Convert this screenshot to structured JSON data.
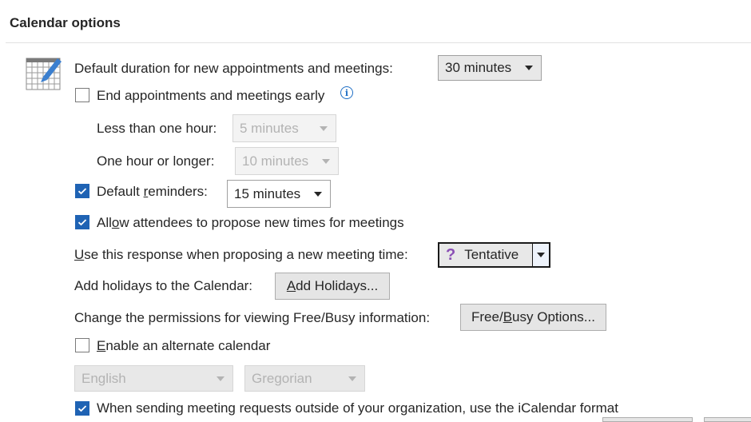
{
  "section": {
    "title": "Calendar options"
  },
  "icons": {
    "calendar": "calendar-edit-icon",
    "info": "info-icon",
    "check": "checkmark-icon",
    "tentative": "question-mark-icon"
  },
  "colors": {
    "accent": "#1f63b4",
    "tentative": "#8a4fb5",
    "info": "#1f6fc5"
  },
  "default_duration": {
    "label": "Default duration for new appointments and meetings:",
    "value": "30 minutes"
  },
  "end_early": {
    "label": "End appointments and meetings early",
    "checked": false
  },
  "less_than_hour": {
    "label": "Less than one hour:",
    "value": "5 minutes"
  },
  "hour_or_longer": {
    "label": "One hour or longer:",
    "value": "10 minutes"
  },
  "default_reminders": {
    "label_pre": "Default ",
    "label_mn": "r",
    "label_post": "eminders:",
    "checked": true,
    "value": "15 minutes"
  },
  "allow_propose": {
    "label_pre": "All",
    "label_mn": "o",
    "label_post": "w attendees to propose new times for meetings",
    "checked": true
  },
  "response": {
    "label_mn": "U",
    "label_post": "se this response when proposing a new meeting time:",
    "value": "Tentative"
  },
  "holidays": {
    "label": "Add holidays to the Calendar:",
    "button_mn": "A",
    "button_post": "dd Holidays..."
  },
  "freebusy": {
    "label": "Change the permissions for viewing Free/Busy information:",
    "button_pre": "Free/",
    "button_mn": "B",
    "button_post": "usy Options..."
  },
  "alternate": {
    "label_mn": "E",
    "label_post": "nable an alternate calendar",
    "checked": false,
    "language": "English",
    "calendar_type": "Gregorian"
  },
  "icalendar": {
    "label": "When sending meeting requests outside of your organization, use the iCalendar format",
    "checked": true
  }
}
